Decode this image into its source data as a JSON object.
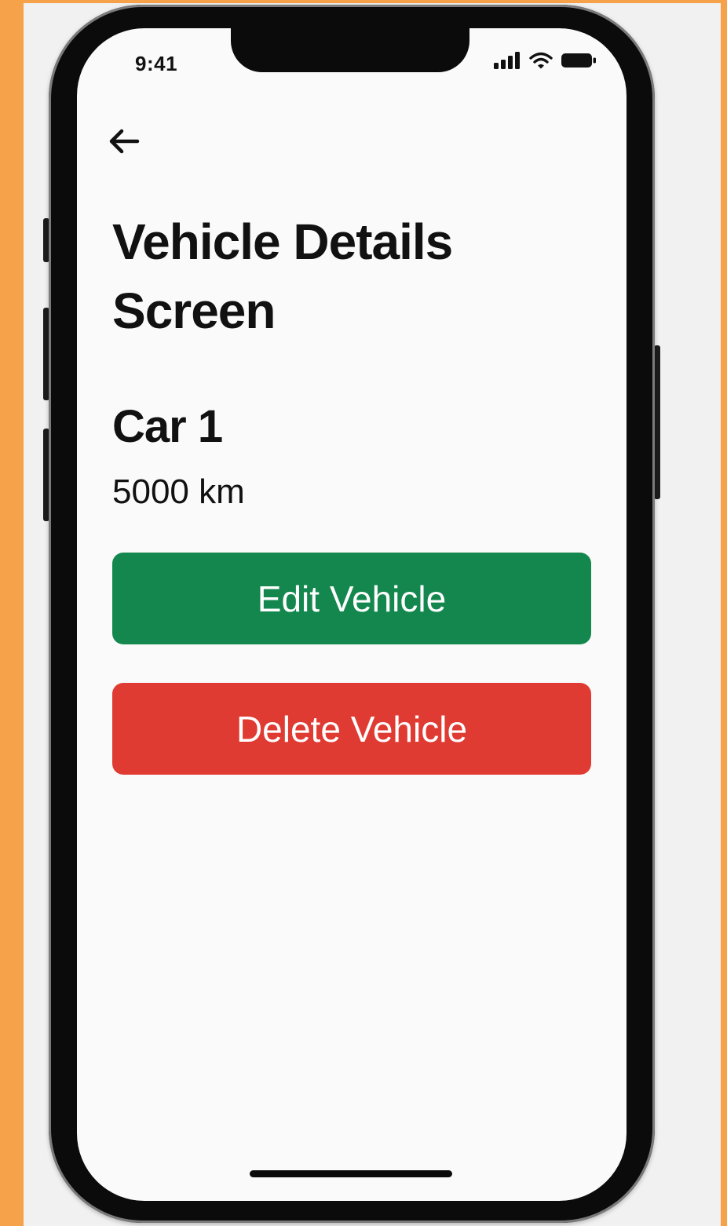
{
  "status_bar": {
    "time": "9:41",
    "icons": [
      "signal-icon",
      "wifi-icon",
      "battery-icon"
    ]
  },
  "header": {
    "back_icon": "arrow-left-icon",
    "title": "Vehicle Details Screen"
  },
  "vehicle": {
    "name": "Car 1",
    "mileage": "5000 km"
  },
  "actions": {
    "edit_label": "Edit Vehicle",
    "delete_label": "Delete Vehicle"
  },
  "colors": {
    "edit_button": "#13874d",
    "delete_button": "#e03b32",
    "frame_background": "#f6a24a",
    "screen_background": "#fafafa"
  }
}
